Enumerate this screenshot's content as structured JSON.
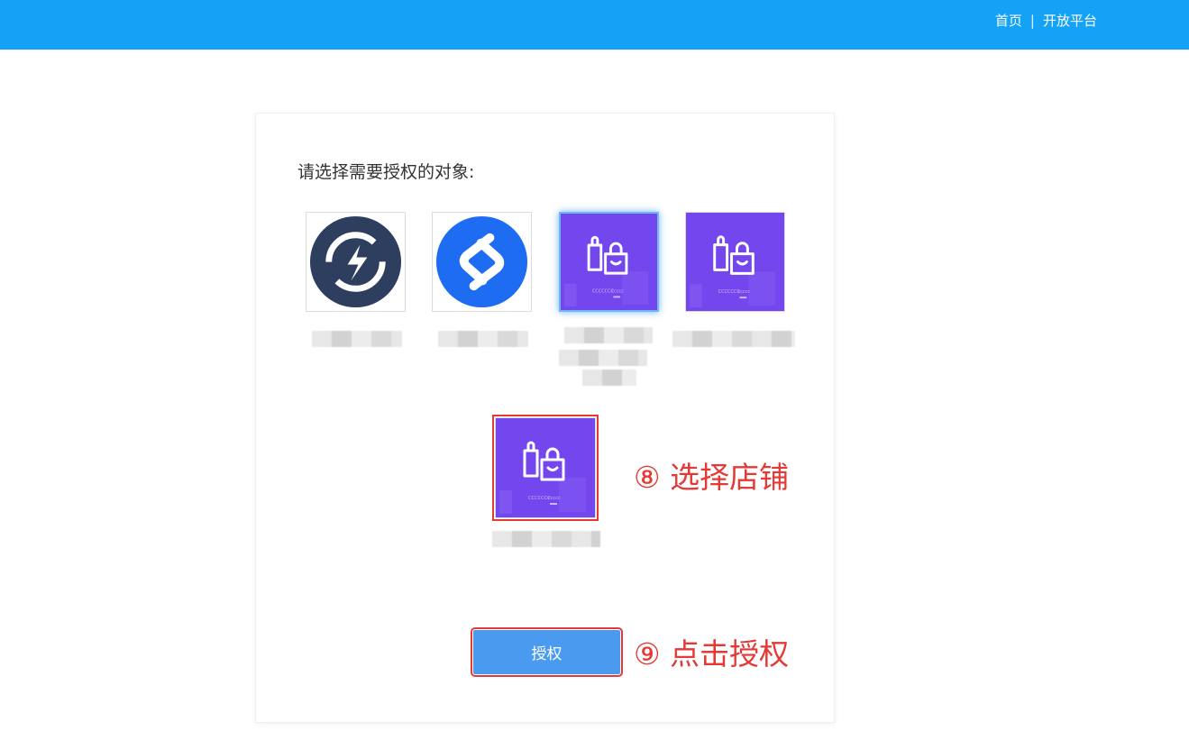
{
  "header": {
    "home_label": "首页",
    "separator": "|",
    "open_platform_label": "开放平台",
    "bar_color": "#14a2f6"
  },
  "main": {
    "prompt": "请选择需要授权的对象:",
    "shops": [
      {
        "icon": "dark-navy-circle-logo-icon",
        "selected": false
      },
      {
        "icon": "blue-circle-s-logo-icon",
        "selected": false
      },
      {
        "icon": "purple-shopping-bag-icon",
        "selected": true
      },
      {
        "icon": "purple-shopping-bag-icon",
        "selected": false
      },
      {
        "icon": "purple-shopping-bag-icon",
        "selected": false,
        "highlighted": true
      }
    ],
    "authorize_button": "授权"
  },
  "annotations": {
    "step8": "⑧ 选择店铺",
    "step9": "⑨ 点击授权",
    "color": "#e53935"
  },
  "colors": {
    "purple_tile": "#7446ee",
    "button": "#4a9bf0"
  }
}
